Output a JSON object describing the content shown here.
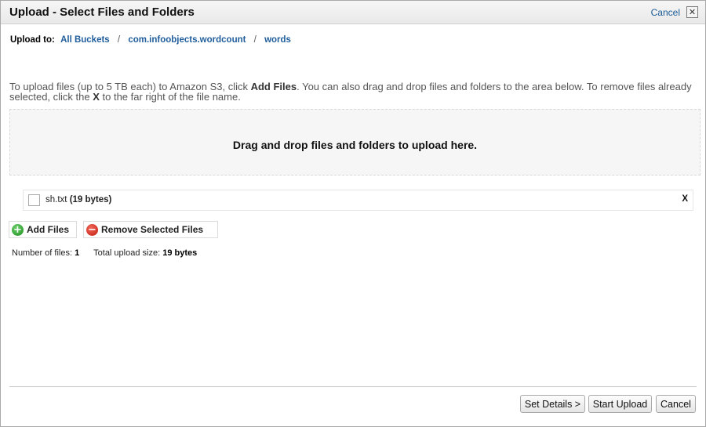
{
  "dialog": {
    "title": "Upload - Select Files and Folders",
    "cancel_label": "Cancel",
    "close_glyph": "✕"
  },
  "breadcrumb": {
    "label": "Upload to:",
    "items": [
      "All Buckets",
      "com.infoobjects.wordcount",
      "words"
    ],
    "separator": "/"
  },
  "instructions": {
    "part1": "To upload files (up to 5 TB each) to Amazon S3, click ",
    "add_files": "Add Files",
    "part2": ". You can also drag and drop files and folders to the area below. To remove files already selected, click the ",
    "x": "X",
    "part3": " to the far right of the file name."
  },
  "dropzone": {
    "text": "Drag and drop files and folders to upload here."
  },
  "files": [
    {
      "name": "sh.txt",
      "size": "(19 bytes)",
      "remove": "X",
      "checked": false
    }
  ],
  "actions": {
    "add_files": "Add Files",
    "remove_selected": "Remove Selected Files",
    "add_icon": "add-circle-icon",
    "remove_icon": "remove-circle-icon"
  },
  "summary": {
    "files_label": "Number of files:",
    "files_value": "1",
    "size_label": "Total upload size:",
    "size_value": "19 bytes"
  },
  "footer": {
    "set_details": "Set Details >",
    "start_upload": "Start Upload",
    "cancel": "Cancel"
  },
  "colors": {
    "link": "#1f5d9b",
    "add_icon": "#1d8a1d",
    "remove_icon": "#c01a10"
  }
}
